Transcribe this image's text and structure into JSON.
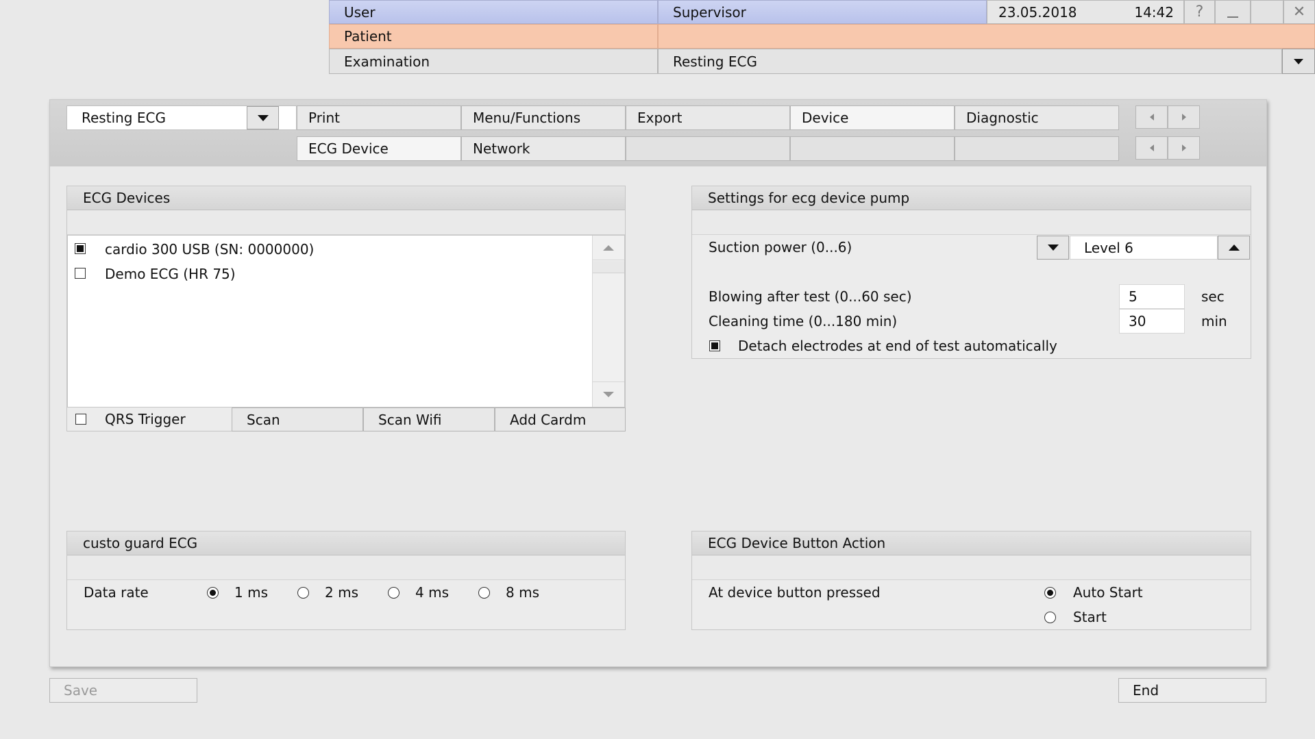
{
  "header": {
    "user_label": "User",
    "user_value": "Supervisor",
    "date": "23.05.2018",
    "time": "14:42",
    "help_glyph": "?",
    "minimize_glyph": "_",
    "close_glyph": "✕",
    "patient_label": "Patient",
    "patient_value": "",
    "exam_label": "Examination",
    "exam_value": "Resting ECG",
    "user_bar_color": "#c2caee",
    "patient_bar_color": "#f8c8ad"
  },
  "toolbar": {
    "module_select": "Resting ECG",
    "tabs_row1": [
      "Print",
      "Menu/Functions",
      "Export",
      "Device",
      "Diagnostic"
    ],
    "tabs_row2": [
      "ECG Device",
      "Network",
      "",
      "",
      ""
    ],
    "active_tab_row1": "Device",
    "active_tab_row2": "ECG Device"
  },
  "ecg_devices": {
    "title": "ECG Devices",
    "items": [
      {
        "label": "cardio 300 USB (SN: 0000000)",
        "checked": true
      },
      {
        "label": "Demo ECG (HR 75)",
        "checked": false
      }
    ],
    "qrs_trigger_label": "QRS Trigger",
    "qrs_trigger_checked": false,
    "scan_label": "Scan",
    "scan_wifi_label": "Scan Wifi",
    "add_cardm_label": "Add Cardm"
  },
  "pump_settings": {
    "title": "Settings for ecg device pump",
    "suction_label": "Suction power (0...6)",
    "suction_value": "Level 6",
    "blowing_label": "Blowing after test (0...60 sec)",
    "blowing_value": "5",
    "blowing_unit": "sec",
    "cleaning_label": "Cleaning time (0...180 min)",
    "cleaning_value": "30",
    "cleaning_unit": "min",
    "detach_label": "Detach electrodes at end of test automatically",
    "detach_checked": true
  },
  "custo_guard": {
    "title": "custo guard ECG",
    "data_rate_label": "Data rate",
    "options": [
      "1 ms",
      "2 ms",
      "4 ms",
      "8 ms"
    ],
    "selected": "1 ms"
  },
  "button_action": {
    "title": "ECG Device Button Action",
    "label": "At device button pressed",
    "options": [
      "Auto Start",
      "Start"
    ],
    "selected": "Auto Start"
  },
  "footer": {
    "save_label": "Save",
    "end_label": "End"
  }
}
